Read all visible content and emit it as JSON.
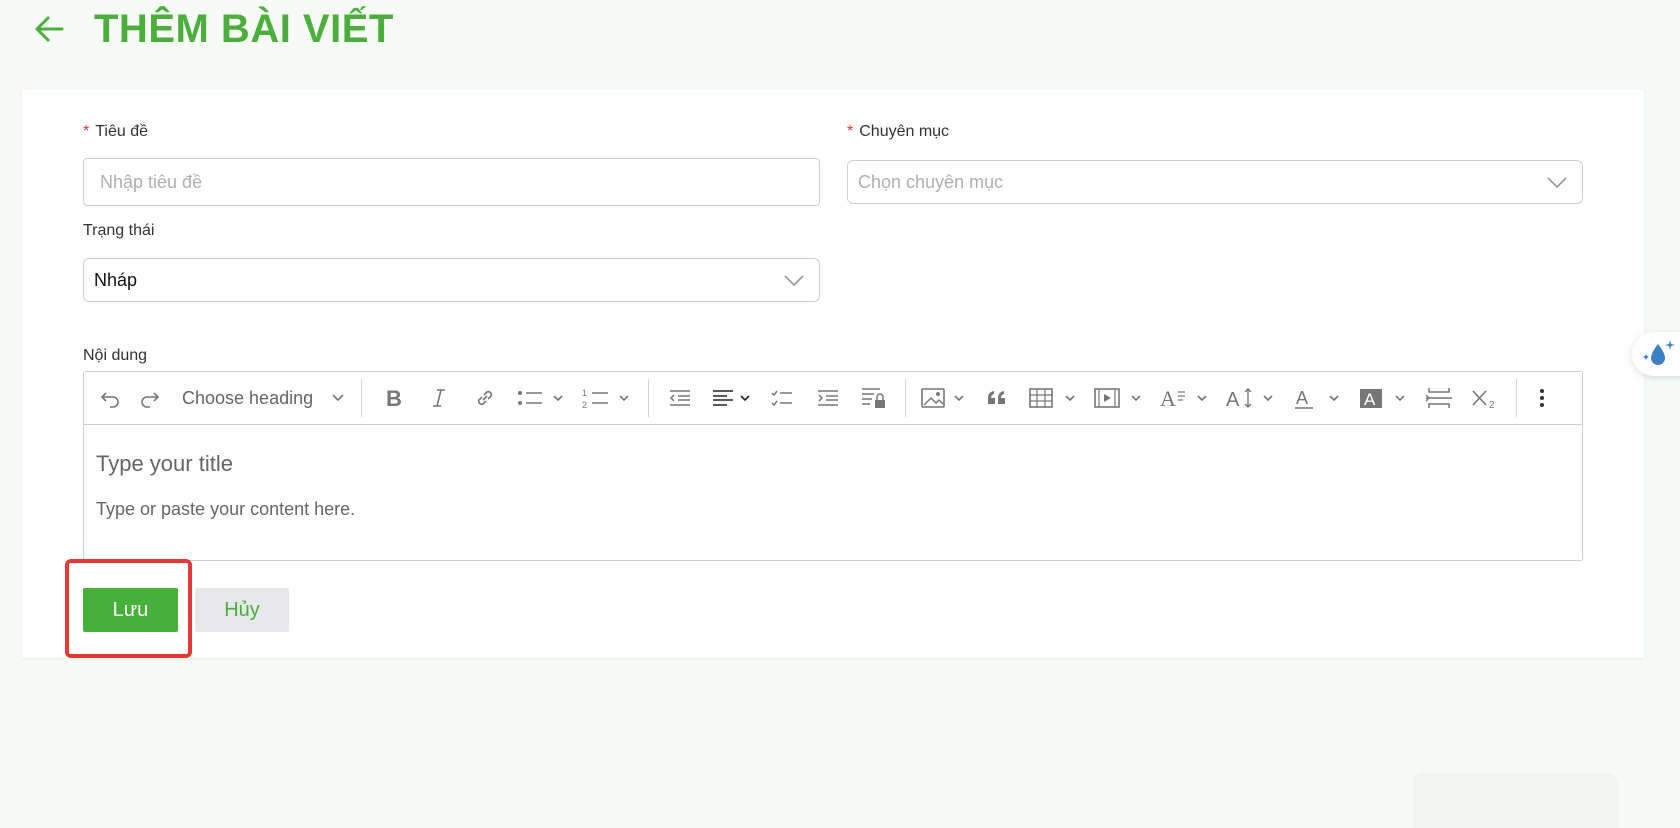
{
  "header": {
    "title": "THÊM BÀI VIẾT"
  },
  "form": {
    "title_label": "Tiêu đề",
    "title_placeholder": "Nhập tiêu đề",
    "category_label": "Chuyên mục",
    "category_placeholder": "Chọn chuyên mục",
    "status_label": "Trạng thái",
    "status_value": "Nháp",
    "content_label": "Nội dung",
    "required_mark": "*"
  },
  "editor": {
    "heading_dropdown": "Choose heading",
    "title_placeholder": "Type your title",
    "content_placeholder": "Type or paste your content here."
  },
  "actions": {
    "save_label": "Lưu",
    "cancel_label": "Hủy"
  },
  "colors": {
    "brand": "#4caf3d",
    "button": "#46b03b",
    "highlight": "#e53935",
    "required": "#e53935"
  }
}
